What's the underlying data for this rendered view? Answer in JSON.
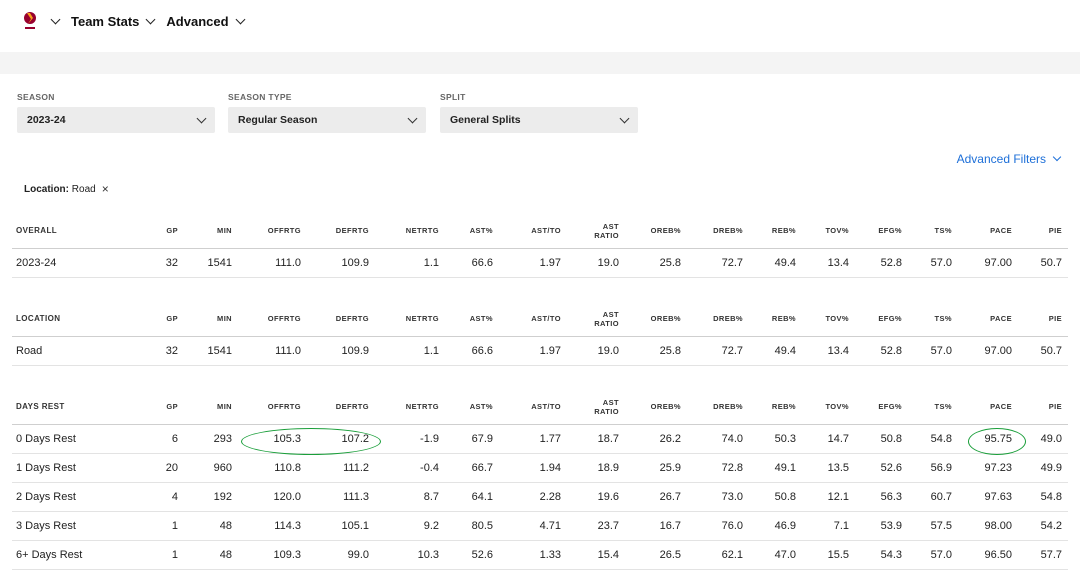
{
  "nav": {
    "items": [
      {
        "label": "Team Stats"
      },
      {
        "label": "Advanced"
      }
    ]
  },
  "filters": [
    {
      "label": "SEASON",
      "value": "2023-24"
    },
    {
      "label": "SEASON TYPE",
      "value": "Regular Season"
    },
    {
      "label": "SPLIT",
      "value": "General Splits"
    }
  ],
  "advanced_filters_label": "Advanced Filters",
  "active_filter": {
    "key": "Location:",
    "value": "Road"
  },
  "columns": [
    "GP",
    "MIN",
    "OFFRTG",
    "DEFRTG",
    "NETRTG",
    "AST%",
    "AST/TO",
    "AST\nRATIO",
    "OREB%",
    "DREB%",
    "REB%",
    "TOV%",
    "EFG%",
    "TS%",
    "PACE",
    "PIE"
  ],
  "tables": [
    {
      "title": "OVERALL",
      "rows": [
        {
          "label": "2023-24",
          "values": [
            "32",
            "1541",
            "111.0",
            "109.9",
            "1.1",
            "66.6",
            "1.97",
            "19.0",
            "25.8",
            "72.7",
            "49.4",
            "13.4",
            "52.8",
            "57.0",
            "97.00",
            "50.7"
          ]
        }
      ]
    },
    {
      "title": "LOCATION",
      "rows": [
        {
          "label": "Road",
          "values": [
            "32",
            "1541",
            "111.0",
            "109.9",
            "1.1",
            "66.6",
            "1.97",
            "19.0",
            "25.8",
            "72.7",
            "49.4",
            "13.4",
            "52.8",
            "57.0",
            "97.00",
            "50.7"
          ]
        }
      ]
    },
    {
      "title": "DAYS REST",
      "rows": [
        {
          "label": "0 Days Rest",
          "values": [
            "6",
            "293",
            "105.3",
            "107.2",
            "-1.9",
            "67.9",
            "1.77",
            "18.7",
            "26.2",
            "74.0",
            "50.3",
            "14.7",
            "50.8",
            "54.8",
            "95.75",
            "49.0"
          ]
        },
        {
          "label": "1 Days Rest",
          "values": [
            "20",
            "960",
            "110.8",
            "111.2",
            "-0.4",
            "66.7",
            "1.94",
            "18.9",
            "25.9",
            "72.8",
            "49.1",
            "13.5",
            "52.6",
            "56.9",
            "97.23",
            "49.9"
          ]
        },
        {
          "label": "2 Days Rest",
          "values": [
            "4",
            "192",
            "120.0",
            "111.3",
            "8.7",
            "64.1",
            "2.28",
            "19.6",
            "26.7",
            "73.0",
            "50.8",
            "12.1",
            "56.3",
            "60.7",
            "97.63",
            "54.8"
          ]
        },
        {
          "label": "3 Days Rest",
          "values": [
            "1",
            "48",
            "114.3",
            "105.1",
            "9.2",
            "80.5",
            "4.71",
            "23.7",
            "16.7",
            "76.0",
            "46.9",
            "7.1",
            "53.9",
            "57.5",
            "98.00",
            "54.2"
          ]
        },
        {
          "label": "6+ Days Rest",
          "values": [
            "1",
            "48",
            "109.3",
            "99.0",
            "10.3",
            "52.6",
            "1.33",
            "15.4",
            "26.5",
            "62.1",
            "47.0",
            "15.5",
            "54.3",
            "57.0",
            "96.50",
            "57.7"
          ]
        }
      ]
    }
  ],
  "colors": {
    "accent": "#1d6fd8",
    "highlight": "#1a9e3a",
    "brand": "#98002e"
  }
}
